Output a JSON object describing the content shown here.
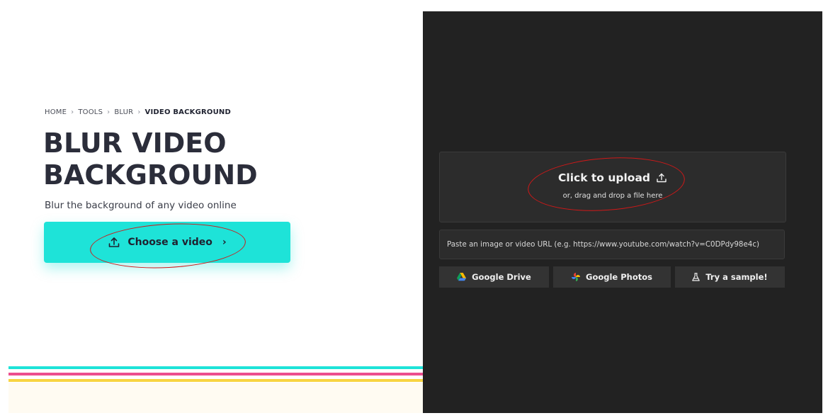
{
  "breadcrumb": {
    "items": [
      "HOME",
      "TOOLS",
      "BLUR"
    ],
    "current": "VIDEO BACKGROUND",
    "separator": "›"
  },
  "hero": {
    "title_line1": "BLUR VIDEO",
    "title_line2": "BACKGROUND",
    "subtitle": "Blur the background of any video online",
    "choose_button_label": "Choose a video",
    "choose_button_chevron": "›"
  },
  "uploader": {
    "title": "Click to upload",
    "subtitle": "or, drag and drop a file here",
    "url_placeholder": "Paste an image or video URL (e.g. https://www.youtube.com/watch?v=C0DPdy98e4c)",
    "buttons": {
      "google_drive": "Google Drive",
      "google_photos": "Google Photos",
      "try_sample": "Try a sample!"
    }
  },
  "colors": {
    "accent_cyan": "#1ee3d8",
    "accent_pink": "#ec4e8e",
    "accent_yellow": "#f8d442",
    "dark_panel": "#222222",
    "annotation_red": "#d01818"
  },
  "icons": {
    "upload": "upload-icon",
    "google_drive": "google-drive-icon",
    "google_photos": "google-photos-icon",
    "flask": "flask-icon"
  }
}
